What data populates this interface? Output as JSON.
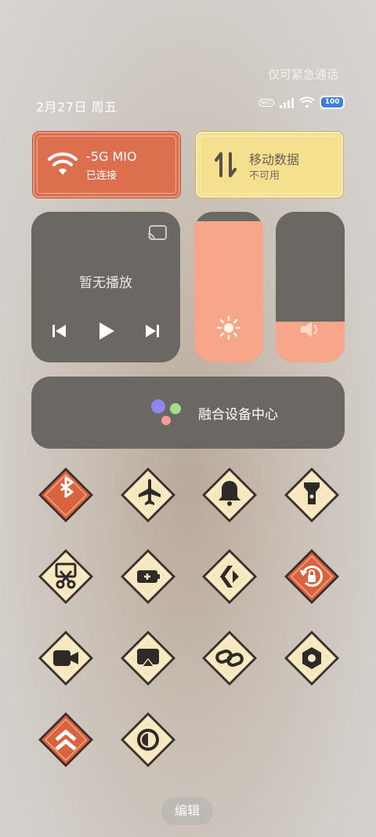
{
  "status": {
    "emergency": "仅可紧急通话",
    "date": "2月27日 周五",
    "battery": "100",
    "nfc": "NFC"
  },
  "wifi_tile": {
    "title": "-5G    MIO",
    "subtitle": "已连接",
    "active": true,
    "icon": "wifi-icon"
  },
  "data_tile": {
    "title": "移动数据",
    "subtitle": "不可用",
    "active": false,
    "icon": "mobile-data-icon"
  },
  "media": {
    "title": "暂无播放",
    "icons": [
      "cast-icon",
      "previous-icon",
      "play-icon",
      "next-icon"
    ]
  },
  "brightness": {
    "level_percent": 94,
    "icon": "sun-icon"
  },
  "volume": {
    "level_percent": 27,
    "icon": "speaker-icon"
  },
  "fusion": {
    "label": "融合设备中心"
  },
  "toggles": [
    {
      "name": "bluetooth",
      "icon": "bluetooth-icon",
      "active": true
    },
    {
      "name": "airplane-mode",
      "icon": "airplane-icon",
      "active": false
    },
    {
      "name": "ring",
      "icon": "bell-icon",
      "active": false
    },
    {
      "name": "flashlight",
      "icon": "flashlight-icon",
      "active": false
    },
    {
      "name": "screenshot",
      "icon": "scissors-icon",
      "active": false
    },
    {
      "name": "battery-saver",
      "icon": "battery-icon",
      "active": false
    },
    {
      "name": "code",
      "icon": "code-icon",
      "active": false
    },
    {
      "name": "rotation-lock",
      "icon": "rotation-lock-icon",
      "active": true
    },
    {
      "name": "screen-record",
      "icon": "video-camera-icon",
      "active": false
    },
    {
      "name": "screencast",
      "icon": "screencast-icon",
      "active": false
    },
    {
      "name": "link",
      "icon": "link-icon",
      "active": false
    },
    {
      "name": "settings",
      "icon": "gear-hex-icon",
      "active": false
    },
    {
      "name": "boost",
      "icon": "double-chevron-up-icon",
      "active": true
    },
    {
      "name": "dark-mode",
      "icon": "contrast-icon",
      "active": false
    }
  ],
  "edit": {
    "label": "编辑"
  },
  "colors": {
    "active_tile": "#dc6f4e",
    "inactive_data_tile": "#f5e08f",
    "toggle_active": "#d9623f",
    "toggle_inactive": "#f7e7bf",
    "panel": "#6b6763",
    "slider_fill": "#f7a68a"
  }
}
